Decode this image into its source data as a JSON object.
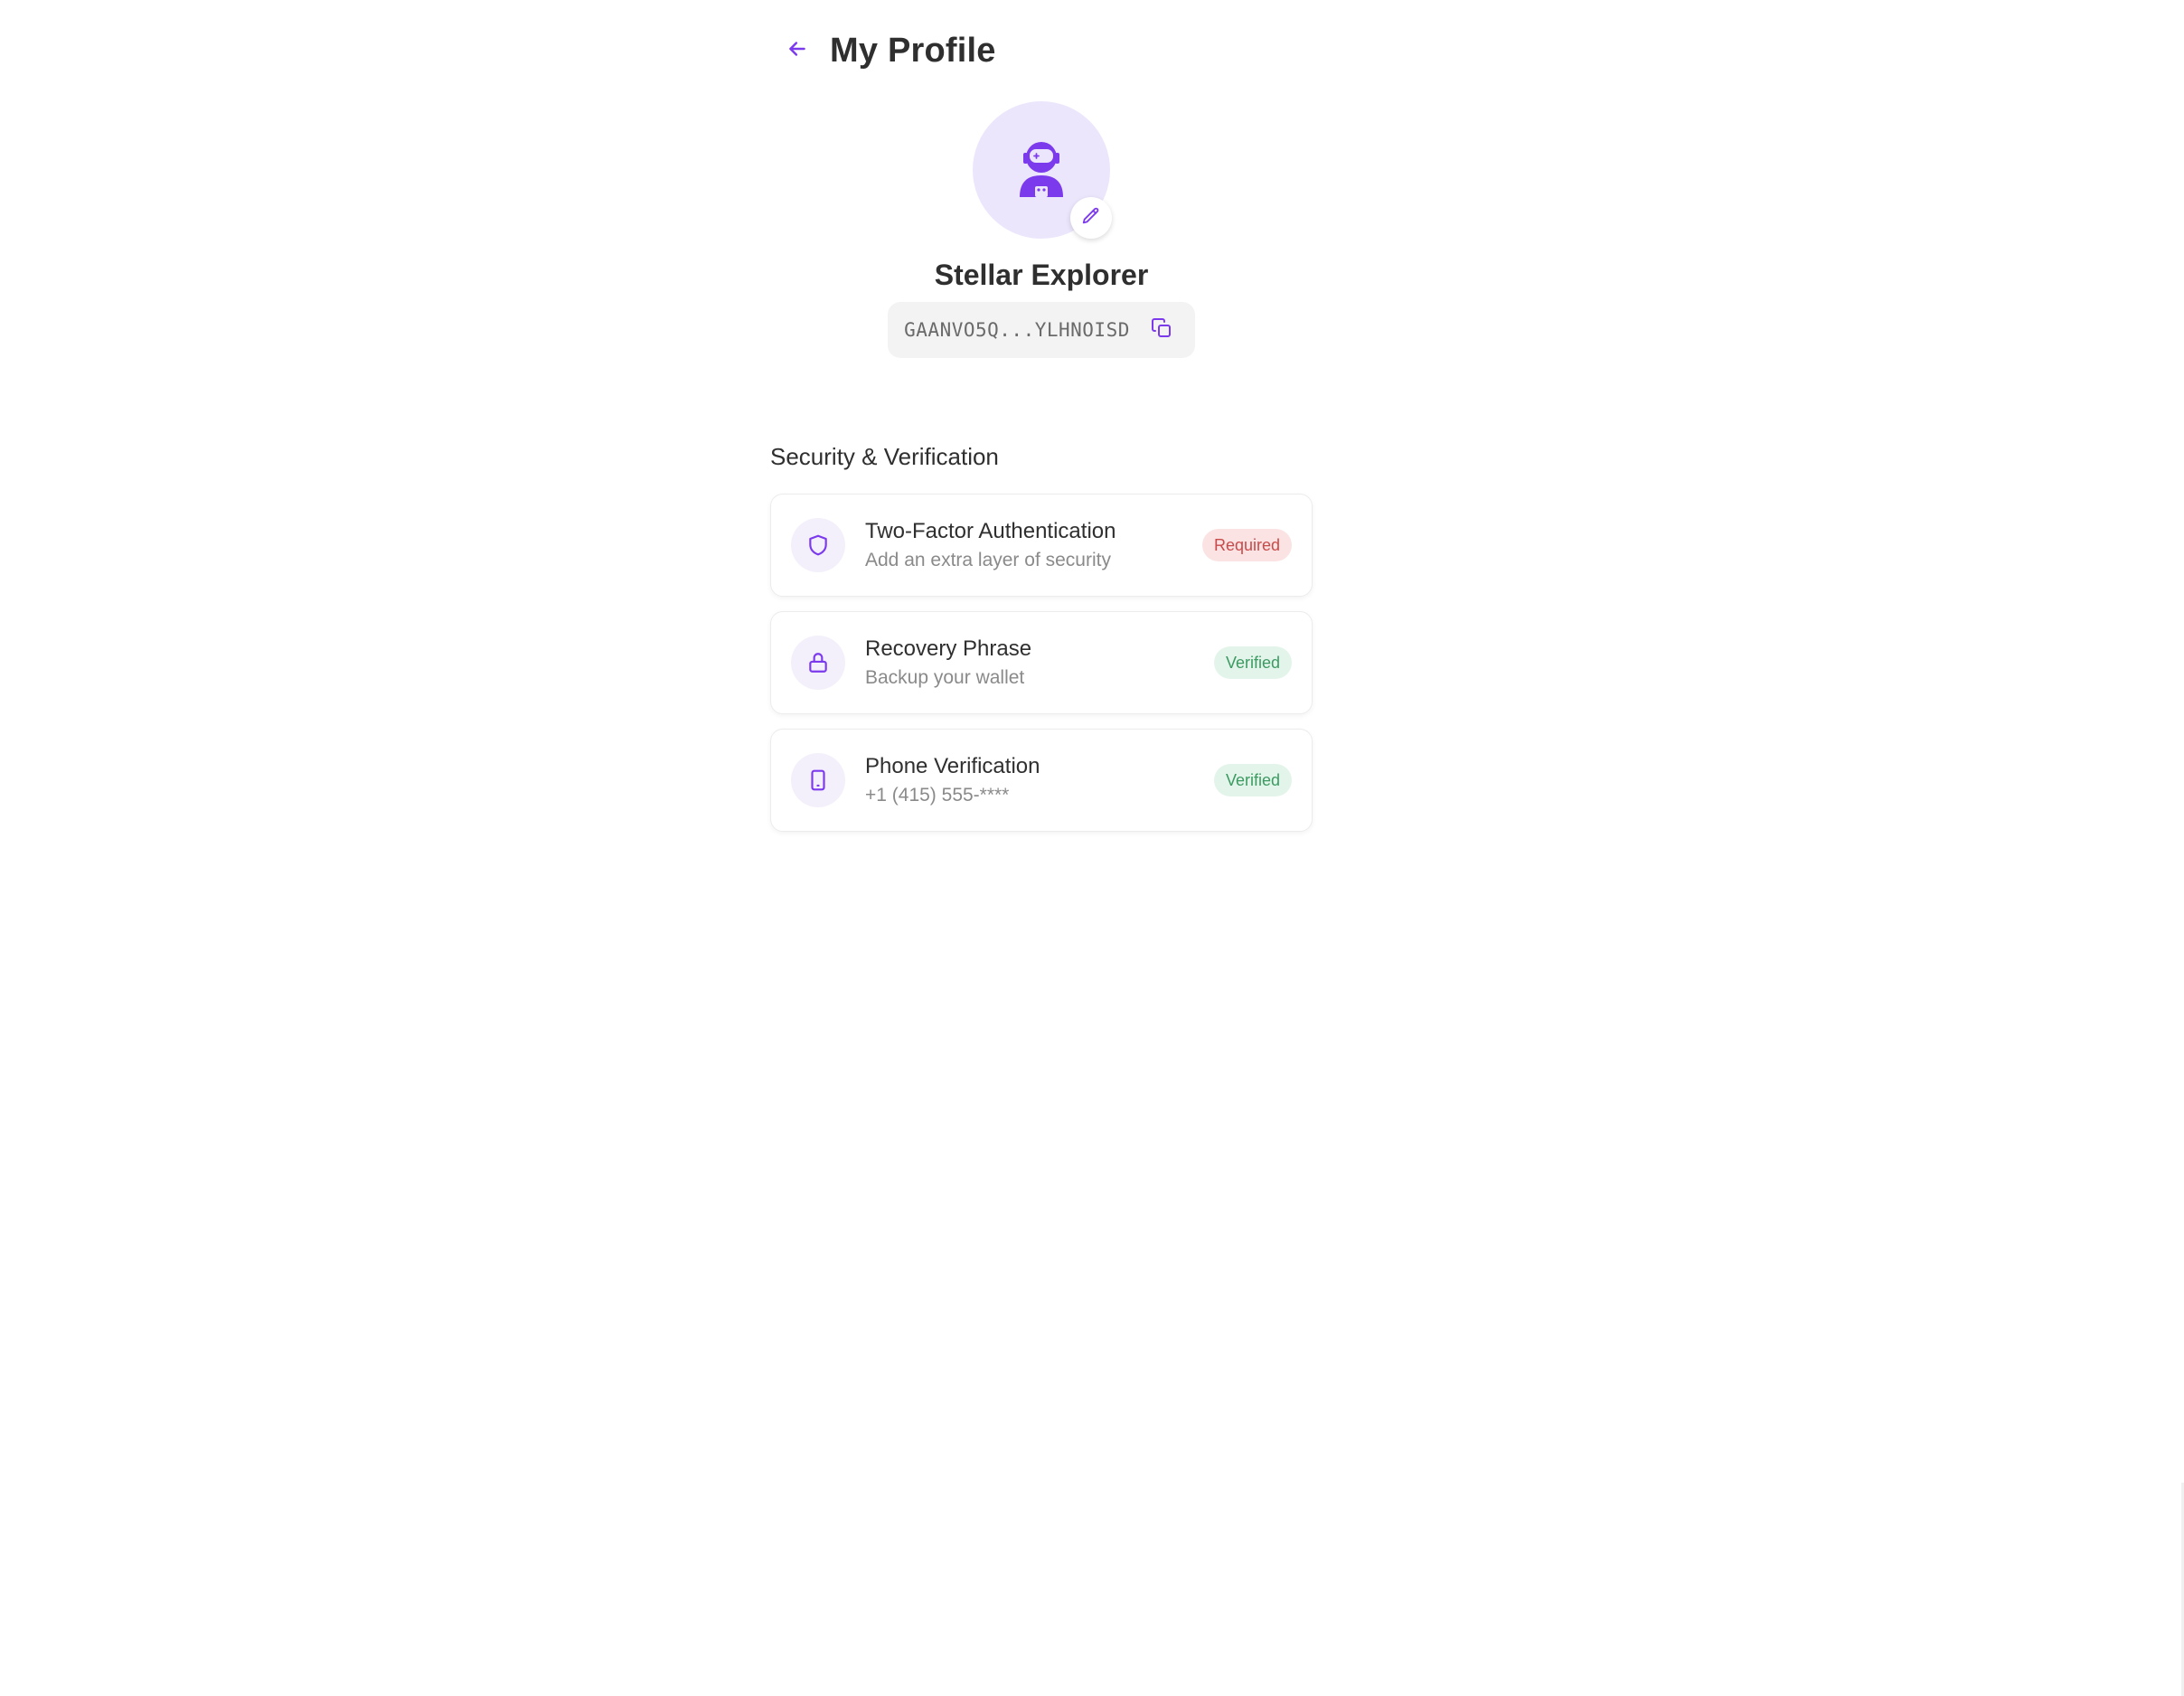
{
  "header": {
    "title": "My Profile",
    "back_icon": "arrow-left-icon"
  },
  "profile": {
    "avatar_icon": "astronaut-icon",
    "edit_icon": "pencil-icon",
    "display_name": "Stellar Explorer",
    "wallet_address": "GAANVO5Q...YLHNOISD",
    "copy_icon": "copy-icon"
  },
  "security": {
    "section_title": "Security & Verification",
    "items": [
      {
        "icon": "shield-icon",
        "title": "Two-Factor Authentication",
        "subtitle": "Add an extra layer of security",
        "status": "Required",
        "status_kind": "required"
      },
      {
        "icon": "lock-icon",
        "title": "Recovery Phrase",
        "subtitle": "Backup your wallet",
        "status": "Verified",
        "status_kind": "verified"
      },
      {
        "icon": "phone-icon",
        "title": "Phone Verification",
        "subtitle": "+1 (415) 555-****",
        "status": "Verified",
        "status_kind": "verified"
      }
    ]
  },
  "colors": {
    "accent": "#7c3aed",
    "avatar_bg": "#ece6fc",
    "required_bg": "#fbe3e3",
    "required_text": "#c94a4a",
    "verified_bg": "#e3f5ea",
    "verified_text": "#3c9a62"
  }
}
